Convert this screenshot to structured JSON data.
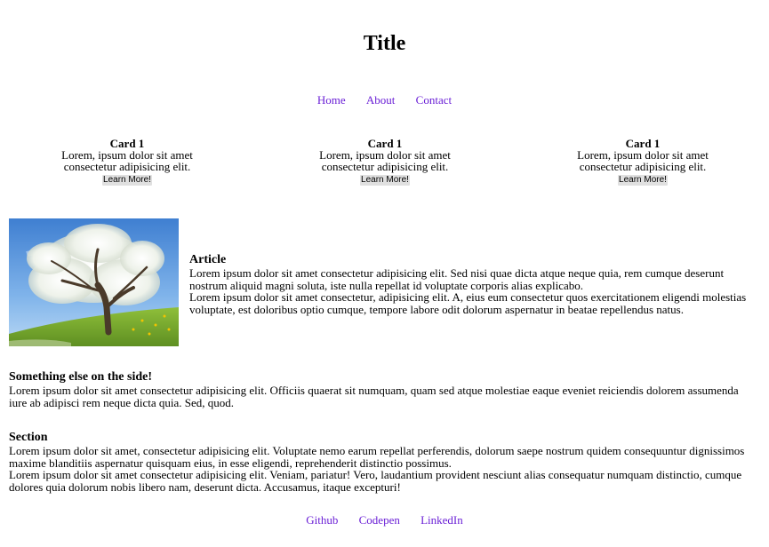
{
  "header": {
    "title": "Title"
  },
  "nav": {
    "items": [
      "Home",
      "About",
      "Contact"
    ]
  },
  "cards": [
    {
      "title": "Card 1",
      "text": "Lorem, ipsum dolor sit amet consectetur adipisicing elit.",
      "button": "Learn More!"
    },
    {
      "title": "Card 1",
      "text": "Lorem, ipsum dolor sit amet consectetur adipisicing elit.",
      "button": "Learn More!"
    },
    {
      "title": "Card 1",
      "text": "Lorem, ipsum dolor sit amet consectetur adipisicing elit.",
      "button": "Learn More!"
    }
  ],
  "article": {
    "heading": "Article",
    "paragraphs": [
      "Lorem ipsum dolor sit amet consectetur adipisicing elit. Sed nisi quae dicta atque neque quia, rem cumque deserunt nostrum aliquid magni soluta, iste nulla repellat id voluptate corporis alias explicabo.",
      "Lorem ipsum dolor sit amet consectetur, adipisicing elit. A, eius eum consectetur quos exercitationem eligendi molestias voluptate, est doloribus optio cumque, tempore labore odit dolorum aspernatur in beatae repellendus natus."
    ]
  },
  "aside": {
    "heading": "Something else on the side!",
    "text": "Lorem ipsum dolor sit amet consectetur adipisicing elit. Officiis quaerat sit numquam, quam sed atque molestiae eaque eveniet reiciendis dolorem assumenda iure ab adipisci rem neque dicta quia. Sed, quod."
  },
  "section": {
    "heading": "Section",
    "paragraphs": [
      "Lorem ipsum dolor sit amet, consectetur adipisicing elit. Voluptate nemo earum repellat perferendis, dolorum saepe nostrum quidem consequuntur dignissimos maxime blanditiis aspernatur quisquam eius, in esse eligendi, reprehenderit distinctio possimus.",
      "Lorem ipsum dolor sit amet consectetur adipisicing elit. Veniam, pariatur! Vero, laudantium provident nesciunt alias consequatur numquam distinctio, cumque dolores quia dolorum nobis libero nam, deserunt dicta. Accusamus, itaque excepturi!"
    ]
  },
  "footer": {
    "links": [
      "Github",
      "Codepen",
      "LinkedIn"
    ]
  },
  "colors": {
    "link": "#6a1fd6",
    "button_bg": "#e0e0e0"
  },
  "image": {
    "subject": "blossoming-tree"
  }
}
